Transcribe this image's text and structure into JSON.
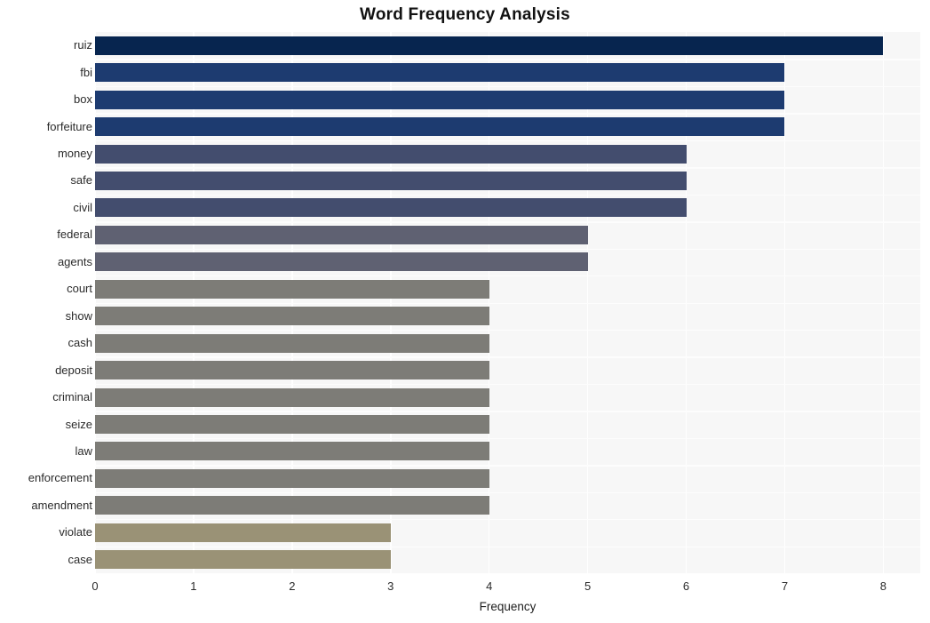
{
  "chart_data": {
    "type": "bar",
    "orientation": "horizontal",
    "title": "Word Frequency Analysis",
    "xlabel": "Frequency",
    "ylabel": "",
    "xlim": [
      0,
      8.375
    ],
    "xticks": [
      0,
      1,
      2,
      3,
      4,
      5,
      6,
      7,
      8
    ],
    "xticklabels": [
      "0",
      "1",
      "2",
      "3",
      "4",
      "5",
      "6",
      "7",
      "8"
    ],
    "grid": true,
    "legend": false,
    "categories": [
      "ruiz",
      "fbi",
      "box",
      "forfeiture",
      "money",
      "safe",
      "civil",
      "federal",
      "agents",
      "court",
      "show",
      "cash",
      "deposit",
      "criminal",
      "seize",
      "law",
      "enforcement",
      "amendment",
      "violate",
      "case"
    ],
    "values": [
      8,
      7,
      7,
      7,
      6,
      6,
      6,
      5,
      5,
      4,
      4,
      4,
      4,
      4,
      4,
      4,
      4,
      4,
      3,
      3
    ],
    "bar_colors": [
      "#07254f",
      "#1d3b70",
      "#1d3b70",
      "#1d3b70",
      "#434d6e",
      "#434d6e",
      "#434d6e",
      "#5f6172",
      "#5f6172",
      "#7d7c77",
      "#7d7c77",
      "#7d7c77",
      "#7d7c77",
      "#7d7c77",
      "#7d7c77",
      "#7d7c77",
      "#7d7c77",
      "#7d7c77",
      "#9a9276",
      "#9a9276"
    ],
    "plot_background": "#f7f7f7",
    "gridline_color": "#ffffff",
    "figure_background": "#ffffff"
  }
}
